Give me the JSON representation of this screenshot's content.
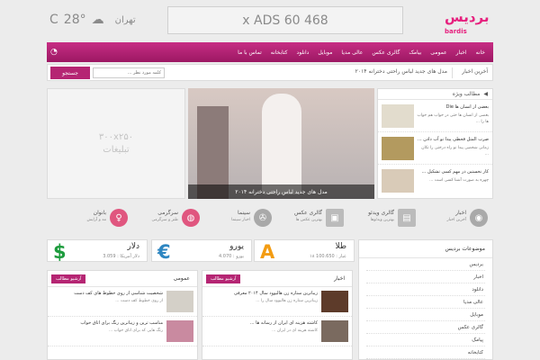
{
  "header": {
    "logo_text": "بردیس",
    "logo_sub": "bardis",
    "ads_text": "x ADS 60 468",
    "weather": {
      "temp": "28°",
      "unit": "C",
      "city": "تهران"
    }
  },
  "nav": {
    "items": [
      "خانه",
      "اخبار",
      "عمومی",
      "بیامک",
      "گالری عکس",
      "عالی مدیا",
      "موبایل",
      "دانلود",
      "کتابخانه",
      "تماس با ما"
    ]
  },
  "newsbar": {
    "label": "آخرین اخبار",
    "ticker": "مدل های جدید لباس راحتی دخترانه ۲۰۱۴",
    "search_placeholder": "کلمه مورد نظر ...",
    "search_button": "جستجو"
  },
  "special": {
    "title": "مطالب ویژه",
    "items": [
      {
        "title": "بعضی از انسان ها Die",
        "excerpt": "بعضی از انسان ها حتی در خواب هم خواب ها را ..."
      },
      {
        "title": "ضرب المثل قحطی پیدا نو آب دادن ...",
        "excerpt": "زمانی شخصی پیدا نو راه درختی را تکان ..."
      },
      {
        "title": "کار نخستین در مهم کسی تشکیل ...",
        "excerpt": "چهره به صورت آشنا کسی است ..."
      }
    ]
  },
  "slider": {
    "caption": "مدل های جدید لباس راحتی دخترانه ۲۰۱۴"
  },
  "ad300": {
    "line1": "۳۰۰x۲۵۰",
    "line2": "تبلیغات"
  },
  "categories": [
    {
      "name": "اخبار",
      "desc": "آخرین اخبار",
      "icon": "globe-icon",
      "glyph": "◉"
    },
    {
      "name": "گالری ویدئو",
      "desc": "بهترین ویدئوها",
      "icon": "film-icon",
      "glyph": "▤"
    },
    {
      "name": "گالری عکس",
      "desc": "بهترین عکس ها",
      "icon": "image-icon",
      "glyph": "▣"
    },
    {
      "name": "سینما",
      "desc": "اخبار سینما",
      "icon": "film-reel-icon",
      "glyph": "✇"
    },
    {
      "name": "سرگرمی",
      "desc": "طنز و سرگرمی",
      "icon": "ghost-icon",
      "glyph": "◍"
    },
    {
      "name": "بانوان",
      "desc": "مد و آرایش",
      "icon": "woman-icon",
      "glyph": "♀"
    }
  ],
  "prices": [
    {
      "name": "طلا",
      "sub": "۱۸ عیار : 100.650",
      "symbol": "A",
      "color": "#f39c12",
      "icon": "gold-icon"
    },
    {
      "name": "یورو",
      "sub": "یورو : 4.070",
      "symbol": "€",
      "color": "#2e86c1",
      "icon": "euro-icon"
    },
    {
      "name": "دلار",
      "sub": "دلار آمریکا : 3.059",
      "symbol": "$",
      "color": "#1e9c3e",
      "icon": "dollar-icon"
    }
  ],
  "sidebar": {
    "title": "موضوعات بردیس",
    "items": [
      "بردیس",
      "اخبار",
      "دانلود",
      "عالی مدیا",
      "موبایل",
      "گالری عکس",
      "پیامک",
      "کتابخانه"
    ]
  },
  "sections": {
    "news": {
      "title": "اخبار",
      "archive": "آرشیو مطالب",
      "rows": [
        {
          "title": "زیباترین ستاره زن هالیوود سال ۲۰۱۴ معرفی",
          "excerpt": "زیباترین ستاره زن هالیوود سال را ..."
        },
        {
          "title": "کاشته هزینه ای ایران از رسانه ها ...",
          "excerpt": "کاشته هزینه ای در ایران ..."
        }
      ]
    },
    "general": {
      "title": "عمومی",
      "archive": "آرشیو مطالب",
      "rows": [
        {
          "title": "شخصیت شناسی از روی خطوط های کف دست",
          "excerpt": "از روی خطوط کف دست ..."
        },
        {
          "title": "مناسب ترین و زیباترین رنگ برای اتاق خواب",
          "excerpt": "رنگ هایی که برای اتاق خواب ..."
        }
      ]
    }
  }
}
